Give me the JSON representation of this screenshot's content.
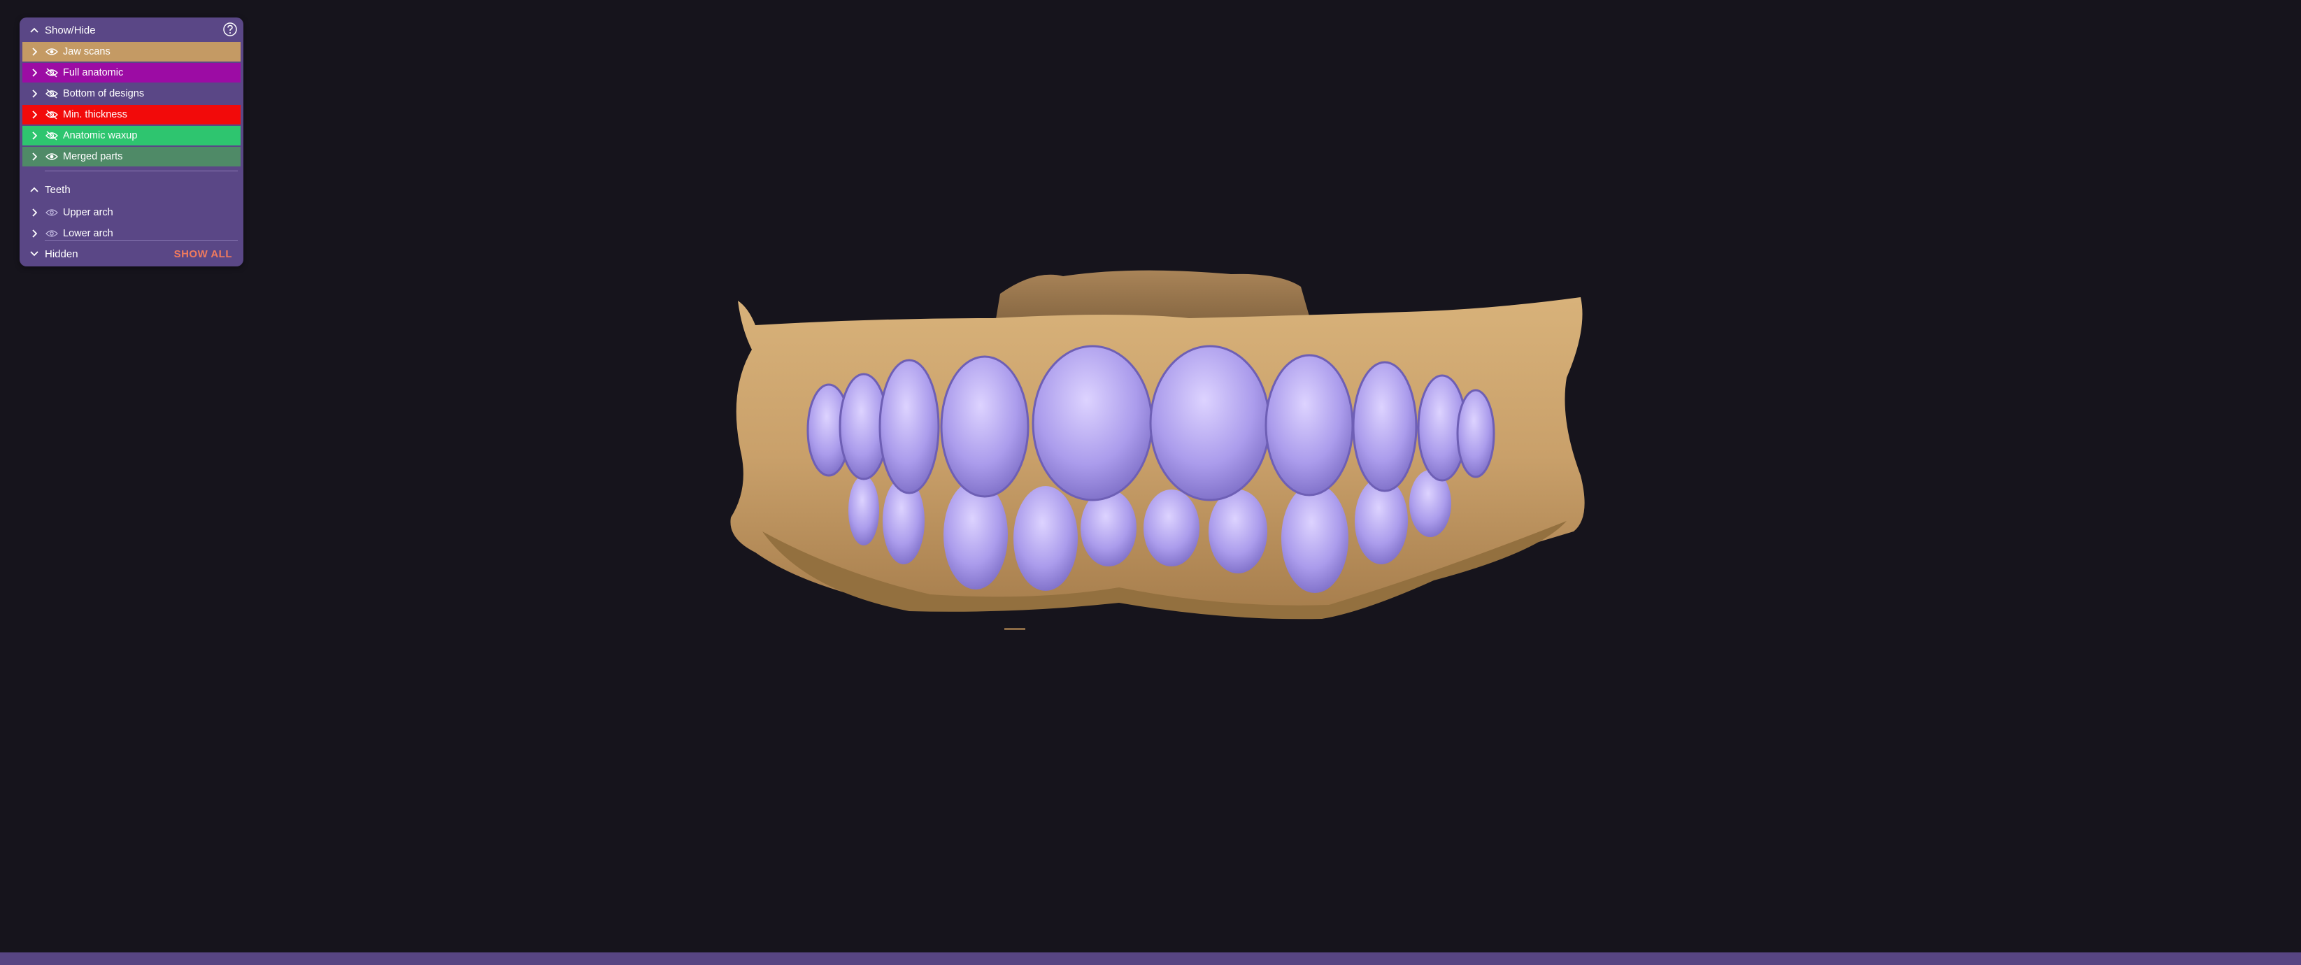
{
  "panel": {
    "title": "Show/Hide",
    "help_icon": "help-circle-icon",
    "layers": [
      {
        "label": "Jaw scans",
        "visible": true,
        "color": "#c49a64"
      },
      {
        "label": "Full anatomic",
        "visible": false,
        "color": "#9c0ca4"
      },
      {
        "label": "Bottom of designs",
        "visible": false,
        "color": "#5a4786"
      },
      {
        "label": "Min. thickness",
        "visible": false,
        "color": "#f20a0a"
      },
      {
        "label": "Anatomic waxup",
        "visible": false,
        "color": "#2ec56f"
      },
      {
        "label": "Merged parts",
        "visible": true,
        "color": "#4f8a67"
      }
    ],
    "teeth": {
      "title": "Teeth",
      "items": [
        {
          "label": "Upper arch",
          "visible": true
        },
        {
          "label": "Lower arch",
          "visible": true
        }
      ]
    },
    "hidden": {
      "title": "Hidden",
      "show_all_label": "SHOW ALL"
    }
  },
  "colors": {
    "background": "#16141c",
    "panel": "#5a4786",
    "accent": "#f07a5e",
    "gum": "#c9a06a",
    "tooth": "#a89ae8"
  }
}
